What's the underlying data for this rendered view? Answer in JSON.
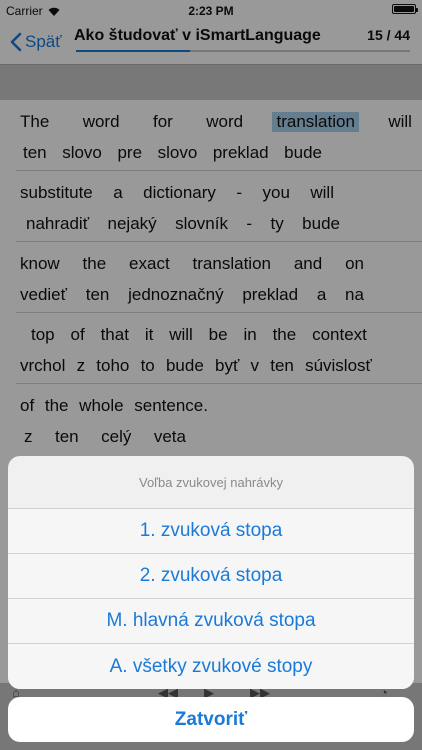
{
  "status_bar": {
    "carrier": "Carrier",
    "time": "2:23 PM"
  },
  "nav": {
    "back_label": "Späť",
    "title": "Ako študovať v iSmartLanguage",
    "page_counter": "15 / 44",
    "progress": 0.34
  },
  "segments": [
    {
      "source": [
        "The",
        "word",
        "for",
        "word",
        "translation",
        "will"
      ],
      "translation": [
        "ten",
        "slovo",
        "pre",
        "slovo",
        "preklad",
        "bude"
      ],
      "highlighted_word": "translation"
    },
    {
      "source": [
        "substitute",
        "a",
        "dictionary",
        "-",
        "you",
        "will"
      ],
      "translation": [
        "nahradiť",
        "nejaký",
        "slovník",
        "-",
        "ty",
        "bude"
      ]
    },
    {
      "source": [
        "know",
        "the",
        "exact",
        "translation",
        "and",
        "on"
      ],
      "translation": [
        "vedieť",
        "ten",
        "jednoznačný",
        "preklad",
        "a",
        "na"
      ]
    },
    {
      "source": [
        "top",
        "of",
        "that",
        "it",
        "will",
        "be",
        "in",
        "the",
        "context"
      ],
      "translation": [
        "vrchol",
        "z",
        "toho",
        "to",
        "bude",
        "byť",
        "v",
        "ten",
        "súvislosť"
      ]
    },
    {
      "source": [
        "of",
        "the",
        "whole",
        "sentence."
      ],
      "translation": [
        "z",
        "ten",
        "celý",
        "veta"
      ]
    }
  ],
  "action_sheet": {
    "title": "Voľba zvukovej nahrávky",
    "options": [
      "1. zvuková stopa",
      "2. zvuková stopa",
      "M. hlavná zvuková stopa",
      "A. všetky zvukové stopy"
    ],
    "cancel_label": "Zatvoriť"
  },
  "colors": {
    "accent": "#1a7ad9",
    "highlight": "#a9d2ee"
  }
}
